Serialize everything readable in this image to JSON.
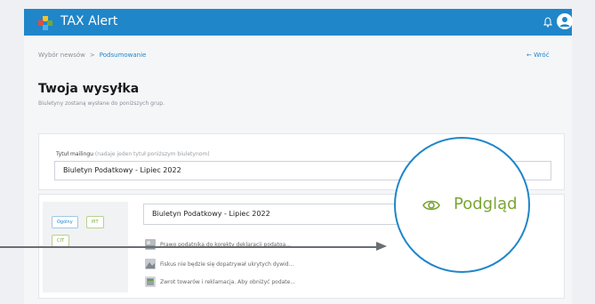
{
  "app": {
    "title": "TAX Alert"
  },
  "breadcrumb": {
    "items": [
      "Wybór newsów",
      "Podsumowanie"
    ],
    "separator": ">",
    "back_label": "← Wróć"
  },
  "heading": "Twoja wysyłka",
  "subheading": "Biuletyny zostaną wysłane do poniższych grup.",
  "mailing": {
    "label": "Tytuł mailingu",
    "hint": "(nadaje jeden tytuł poniższym biuletynom)",
    "value": "Biuletyn Podatkowy - Lipiec 2022"
  },
  "bulletin": {
    "tags": [
      {
        "label": "Ogólny",
        "color": "blue"
      },
      {
        "label": "PIT",
        "color": "green"
      },
      {
        "label": "CIT",
        "color": "green"
      }
    ],
    "title": "Biuletyn Podatkowy - Lipiec 2022",
    "articles": [
      "Prawo podatnika do korekty deklaracji podatga...",
      "Fiskus nie będzie się dopatrywał ukrytych dywid...",
      "Zwrot towarów i reklamacja. Aby obniżyć podate..."
    ]
  },
  "preview": {
    "label": "Podgląd",
    "icon": "eye-icon"
  },
  "colors": {
    "primary": "#1f86c9",
    "accent_green": "#7aa535",
    "background": "#f5f6f8"
  }
}
